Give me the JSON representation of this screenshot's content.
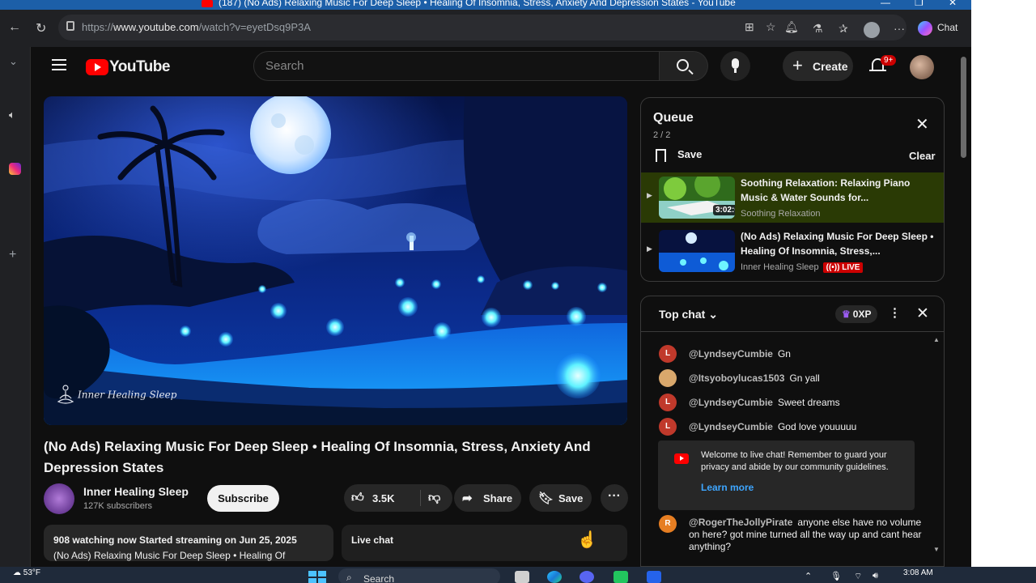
{
  "browser": {
    "window_title": "(187) (No Ads) Relaxing Music For Deep Sleep • Healing Of Insomnia, Stress, Anxiety And Depression States - YouTube",
    "url_prefix": "https://",
    "url_host": "www.youtube.com",
    "url_path": "/watch?v=eyetDsq9P3A",
    "chat_label": "Chat"
  },
  "header": {
    "logo_text": "YouTube",
    "search_placeholder": "Search",
    "create_label": "Create",
    "notif_badge": "9+"
  },
  "video": {
    "watermark": "Inner Healing Sleep",
    "title": "(No Ads) Relaxing Music For Deep Sleep • Healing Of Insomnia, Stress, Anxiety And Depression States"
  },
  "channel": {
    "name": "Inner Healing Sleep",
    "subscribers": "127K subscribers",
    "subscribe_label": "Subscribe"
  },
  "actions": {
    "likes": "3.5K",
    "share_label": "Share",
    "save_label": "Save"
  },
  "description": {
    "line1": "908 watching now  Started streaming on Jun 25, 2025",
    "line2": "(No Ads) Relaxing Music For Deep Sleep • Healing Of"
  },
  "live_chat_box_label": "Live chat",
  "queue": {
    "title": "Queue",
    "count": "2 / 2",
    "save_label": "Save",
    "clear_label": "Clear",
    "items": [
      {
        "title": "Soothing Relaxation: Relaxing Piano Music & Water Sounds for...",
        "channel": "Soothing Relaxation",
        "duration": "3:02:04"
      },
      {
        "title": "(No Ads) Relaxing Music For Deep Sleep • Healing Of Insomnia, Stress,...",
        "channel": "Inner Healing Sleep",
        "badge": "LIVE"
      }
    ]
  },
  "chat": {
    "mode_label": "Top chat",
    "xp_label": "0XP",
    "messages": [
      {
        "author": "@LyndseyCumbie",
        "text": "Gn",
        "initial": "L",
        "color": "#c0392b"
      },
      {
        "author": "@Itsyoboylucas1503",
        "text": "Gn yall",
        "initial": "",
        "color": "#d9a86c"
      },
      {
        "author": "@LyndseyCumbie",
        "text": "Sweet dreams",
        "initial": "L",
        "color": "#c0392b"
      },
      {
        "author": "@LyndseyCumbie",
        "text": "God love youuuuu",
        "initial": "L",
        "color": "#c0392b"
      }
    ],
    "welcome_text": "Welcome to live chat! Remember to guard your privacy and abide by our community guidelines.",
    "learn_more": "Learn more",
    "last_message": {
      "author": "@RogerTheJollyPirate",
      "text": "anyone else have no volume on here? got mine turned all the way up and cant hear anything?",
      "initial": "R",
      "color": "#e67e22"
    }
  },
  "taskbar": {
    "weather": "53°F",
    "search_label": "Search",
    "time": "3:08 AM"
  }
}
